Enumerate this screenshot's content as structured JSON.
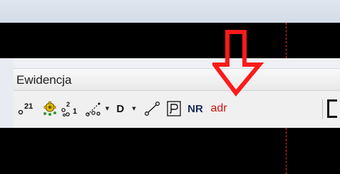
{
  "panel": {
    "title": "Ewidencja"
  },
  "toolbar": {
    "buttons": [
      {
        "name": "point-number-21-button",
        "icon": "point-number-icon",
        "label": "21"
      },
      {
        "name": "import-points-button",
        "icon": "gear-points-icon"
      },
      {
        "name": "renumber-points-button",
        "icon": "renumber-points-icon",
        "label_top": "2",
        "label_bottom": "1"
      },
      {
        "name": "line-points-dropdown",
        "icon": "line-points-icon"
      },
      {
        "name": "d-dropdown",
        "label": "D"
      },
      {
        "name": "line-segment-button",
        "icon": "line-segment-icon"
      },
      {
        "name": "parcel-p-button",
        "icon": "parcel-p-icon"
      },
      {
        "name": "nr-button",
        "label": "NR"
      },
      {
        "name": "adr-button",
        "label": "adr"
      }
    ]
  },
  "annotation": {
    "arrow_color": "#ff1a1a"
  },
  "colors": {
    "canvas": "#000000",
    "guide_line": "#ff2a2a",
    "adr_text": "#d01010"
  }
}
